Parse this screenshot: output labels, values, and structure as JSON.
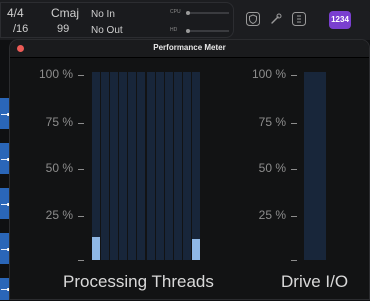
{
  "transport": {
    "time_signature_top": "4/4",
    "time_signature_bottom": "/16",
    "key": "Cmaj",
    "tempo": "99",
    "midi_in": "No In",
    "midi_out": "No Out",
    "cpu_label": "CPU",
    "hd_label": "HD"
  },
  "toolbar": {
    "count_in_label": "1234",
    "accent_color": "#7a3fd0"
  },
  "window": {
    "title": "Performance Meter"
  },
  "meter": {
    "ticks": [
      "100 %",
      "75 %",
      "50 %",
      "25 %"
    ],
    "processing_threads_label": "Processing Threads",
    "drive_io_label": "Drive I/O",
    "thread_levels": [
      0.12,
      0,
      0,
      0,
      0,
      0,
      0,
      0,
      0,
      0,
      0,
      0.11
    ],
    "drive_io_level": 0
  }
}
